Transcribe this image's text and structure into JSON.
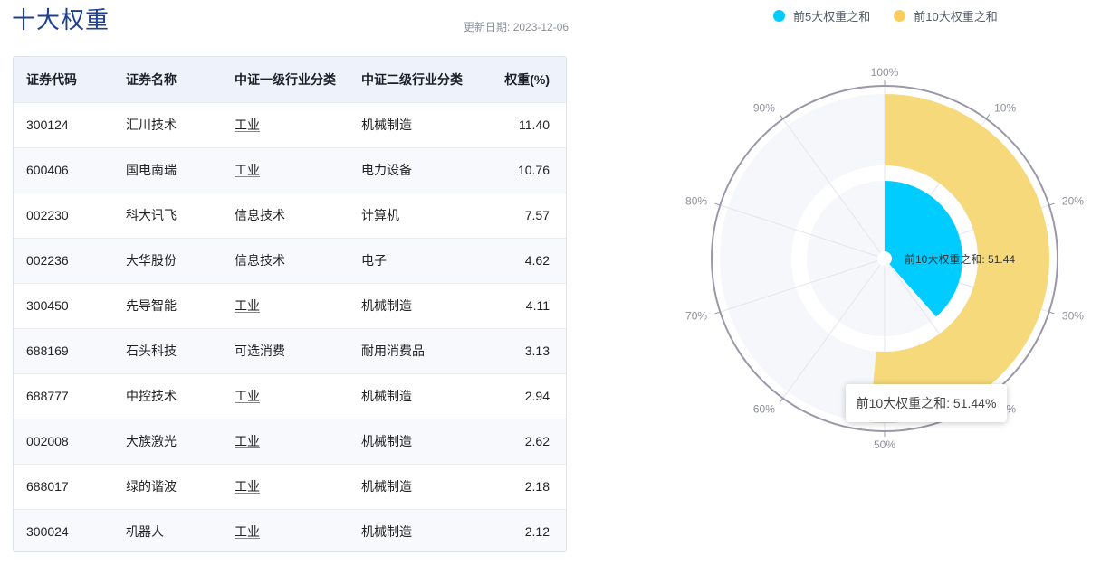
{
  "page": {
    "title": "十大权重",
    "update_label": "更新日期:",
    "update_date": "2023-12-06"
  },
  "table": {
    "headers": [
      "证券代码",
      "证券名称",
      "中证一级行业分类",
      "中证二级行业分类",
      "权重(%)"
    ],
    "rows": [
      [
        "300124",
        "汇川技术",
        "工业",
        "机械制造",
        "11.40"
      ],
      [
        "600406",
        "国电南瑞",
        "工业",
        "电力设备",
        "10.76"
      ],
      [
        "002230",
        "科大讯飞",
        "信息技术",
        "计算机",
        "7.57"
      ],
      [
        "002236",
        "大华股份",
        "信息技术",
        "电子",
        "4.62"
      ],
      [
        "300450",
        "先导智能",
        "工业",
        "机械制造",
        "4.11"
      ],
      [
        "688169",
        "石头科技",
        "可选消费",
        "耐用消费品",
        "3.13"
      ],
      [
        "688777",
        "中控技术",
        "工业",
        "机械制造",
        "2.94"
      ],
      [
        "002008",
        "大族激光",
        "工业",
        "机械制造",
        "2.62"
      ],
      [
        "688017",
        "绿的谐波",
        "工业",
        "机械制造",
        "2.18"
      ],
      [
        "300024",
        "机器人",
        "工业",
        "机械制造",
        "2.12"
      ]
    ]
  },
  "colors": {
    "top5": "#00ccff",
    "top10": "#f5d97b",
    "top10_legend": "#fbcd5a",
    "background_ring": "#f6f7fb",
    "title": "#1f3f8f"
  },
  "chart_data": {
    "type": "polar-bar",
    "series": [
      {
        "name": "前5大权重之和",
        "value": 38.46
      },
      {
        "name": "前10大权重之和",
        "value": 51.44
      }
    ],
    "angle_axis": {
      "min": 0,
      "max": 100,
      "tick_labels": [
        "100%",
        "10%",
        "20%",
        "30%",
        "40%",
        "50%",
        "60%",
        "70%",
        "80%",
        "90%"
      ]
    },
    "inline_label": "前10大权重之和: 51.44",
    "tooltip": {
      "text": "前10大权重之和: 51.44%"
    },
    "legend_position": "top"
  }
}
